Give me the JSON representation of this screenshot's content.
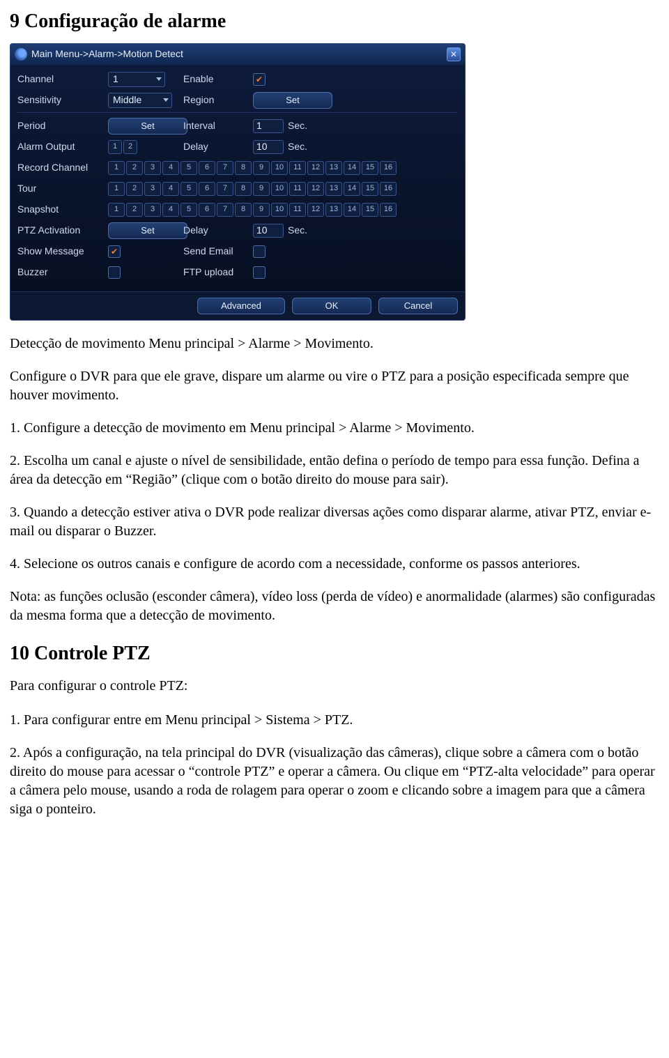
{
  "section9": {
    "title": "9 Configuração de alarme",
    "intro": "Detecção de movimento Menu principal > Alarme > Movimento.",
    "p_config": "Configure o DVR para que ele grave, dispare um alarme ou vire o PTZ para a posição especificada sempre que houver movimento.",
    "step1": "1. Configure a detecção de movimento em Menu principal > Alarme > Movimento.",
    "step2": "2. Escolha um canal e ajuste o nível de sensibilidade, então defina o período de tempo para essa função. Defina a área da detecção em “Região” (clique com o botão direito do mouse para sair).",
    "step3": "3. Quando a detecção estiver ativa o DVR pode realizar diversas ações como disparar alarme, ativar PTZ, enviar e-mail ou disparar o Buzzer.",
    "step4": "4. Selecione os outros canais e configure de acordo com a necessidade, conforme os passos anteriores.",
    "note": "Nota: as funções oclusão (esconder câmera), vídeo loss (perda de vídeo) e anormalidade (alarmes) são configuradas da mesma forma que a detecção de movimento."
  },
  "section10": {
    "title": "10 Controle PTZ",
    "intro": "Para configurar o controle PTZ:",
    "step1": "1. Para configurar entre em Menu principal > Sistema > PTZ.",
    "step2": "2. Após a configuração, na tela principal do DVR (visualização das câmeras), clique sobre a câmera com o botão direito do mouse para acessar o “controle PTZ” e operar a câmera. Ou clique em “PTZ-alta velocidade” para operar a câmera pelo mouse, usando a roda de rolagem para operar o zoom e clicando sobre a imagem para que a câmera siga o ponteiro."
  },
  "dialog": {
    "title": "Main Menu->Alarm->Motion Detect",
    "labels": {
      "channel": "Channel",
      "enable": "Enable",
      "sensitivity": "Sensitivity",
      "region": "Region",
      "period": "Period",
      "interval": "Interval",
      "alarm_output": "Alarm Output",
      "delay": "Delay",
      "record_channel": "Record Channel",
      "tour": "Tour",
      "snapshot": "Snapshot",
      "ptz_activation": "PTZ Activation",
      "show_message": "Show Message",
      "send_email": "Send Email",
      "buzzer": "Buzzer",
      "ftp_upload": "FTP upload"
    },
    "values": {
      "channel": "1",
      "sensitivity": "Middle",
      "interval": "1",
      "alarm_delay": "10",
      "ptz_delay": "10",
      "sec": "Sec.",
      "set": "Set"
    },
    "checks": {
      "enable": true,
      "show_message": true,
      "send_email": false,
      "buzzer": false,
      "ftp_upload": false
    },
    "alarm_outputs": [
      "1",
      "2"
    ],
    "channels16": [
      "1",
      "2",
      "3",
      "4",
      "5",
      "6",
      "7",
      "8",
      "9",
      "10",
      "11",
      "12",
      "13",
      "14",
      "15",
      "16"
    ],
    "footer": {
      "advanced": "Advanced",
      "ok": "OK",
      "cancel": "Cancel"
    }
  }
}
